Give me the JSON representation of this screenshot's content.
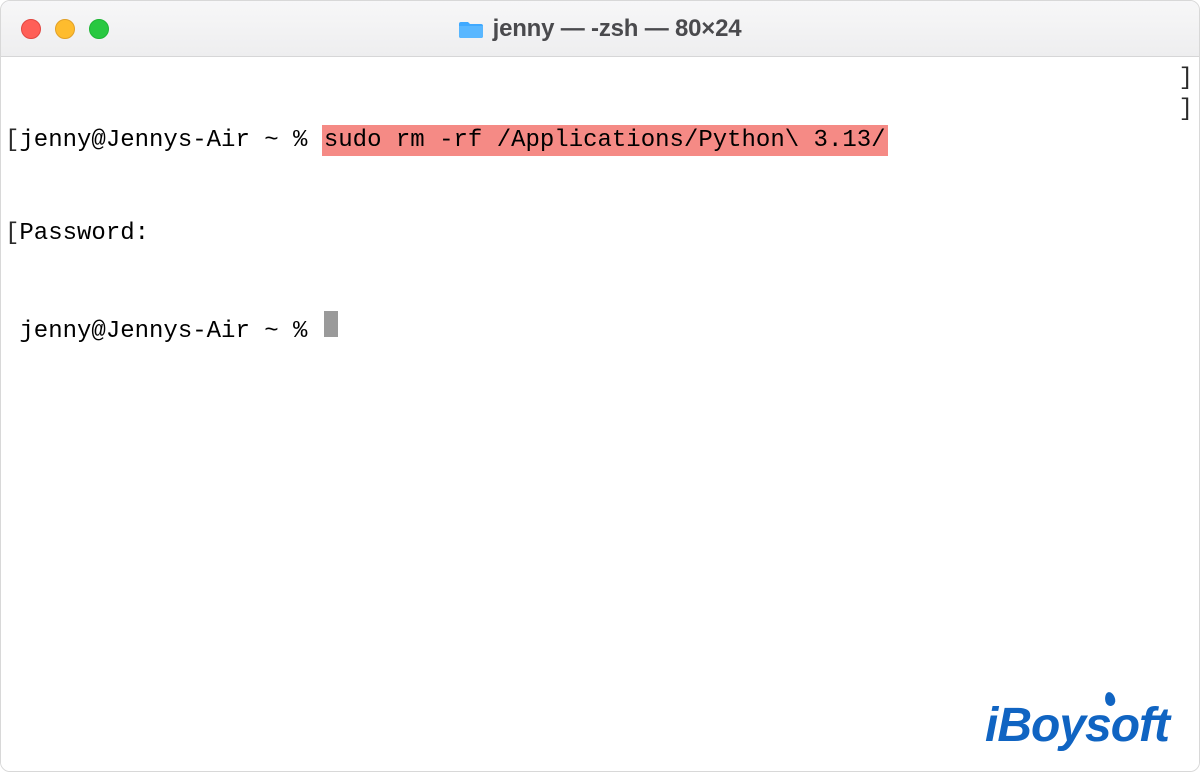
{
  "titlebar": {
    "title": "jenny — -zsh — 80×24"
  },
  "terminal": {
    "line1": {
      "left_bracket": "[",
      "prompt": "jenny@Jennys-Air ~ % ",
      "command": "sudo rm -rf /Applications/Python\\ 3.13/",
      "right_bracket": "]"
    },
    "line2": {
      "left_bracket": "[",
      "text": "Password:",
      "right_bracket": "]"
    },
    "line3": {
      "prompt": " jenny@Jennys-Air ~ % "
    }
  },
  "watermark": {
    "text": "iBoysoft"
  },
  "icons": {
    "folder": "folder-icon",
    "close": "close-traffic-light",
    "minimize": "minimize-traffic-light",
    "maximize": "maximize-traffic-light"
  },
  "colors": {
    "highlight": "#f58a85",
    "brand": "#1064c2",
    "close": "#ff5f57",
    "min": "#febc2e",
    "max": "#28c840"
  }
}
